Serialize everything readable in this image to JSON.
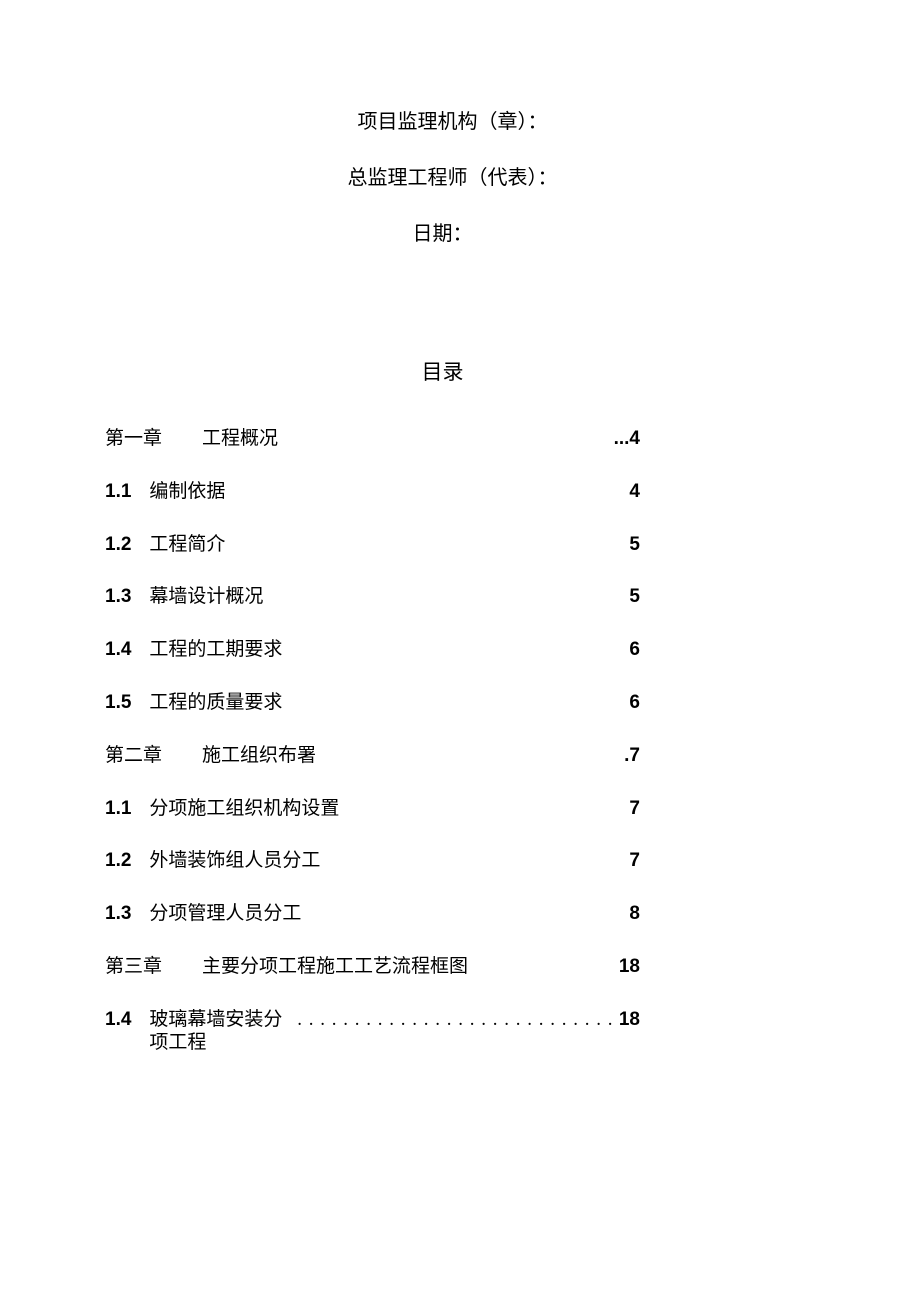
{
  "signature": {
    "line1": "项目监理机构（章）：",
    "line2": "总监理工程师（代表）：",
    "line3": "日期："
  },
  "toc_title": "目录",
  "toc": [
    {
      "kind": "chapter",
      "num": "第一章",
      "label": "工程概况",
      "page": "...4"
    },
    {
      "kind": "item",
      "num": "1.1",
      "label": "编制依据",
      "page": "4"
    },
    {
      "kind": "item",
      "num": "1.2",
      "label": "工程简介",
      "page": "5"
    },
    {
      "kind": "item",
      "num": "1.3",
      "label": "幕墙设计概况",
      "page": "5"
    },
    {
      "kind": "item",
      "num": "1.4",
      "label": "工程的工期要求",
      "page": "6"
    },
    {
      "kind": "item",
      "num": "1.5",
      "label": "工程的质量要求",
      "page": "6"
    },
    {
      "kind": "chapter",
      "num": "第二章",
      "label": "施工组织布署",
      "page": ".7"
    },
    {
      "kind": "item",
      "num": "1.1",
      "label": "分项施工组织机构设置",
      "page": "7"
    },
    {
      "kind": "item",
      "num": "1.2",
      "label": "外墙装饰组人员分工",
      "page": "7"
    },
    {
      "kind": "item",
      "num": "1.3",
      "label": "分项管理人员分工",
      "page": "8"
    },
    {
      "kind": "chapter",
      "num": "第三章",
      "label": "主要分项工程施工工艺流程框图",
      "page": "18"
    },
    {
      "kind": "dotted",
      "num": "1.4",
      "label": "玻璃幕墙安装分项工程",
      "page": "18"
    }
  ]
}
